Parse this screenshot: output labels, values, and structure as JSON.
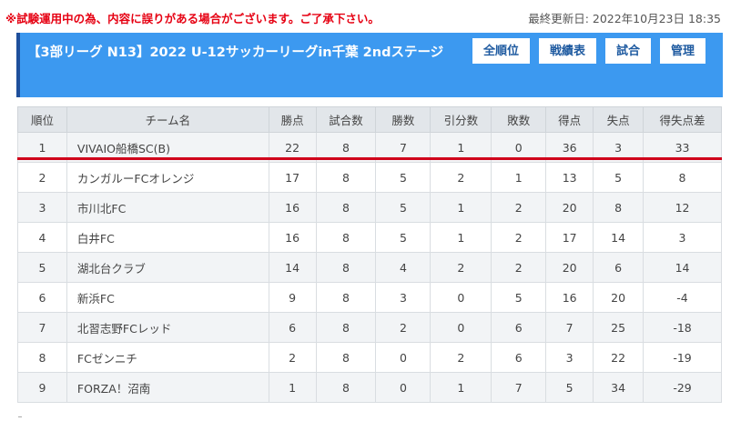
{
  "notice": "※試験運用中の為、内容に誤りがある場合がございます。ご了承下さい。",
  "last_updated": "最終更新日: 2022年10月23日 18:35",
  "header": {
    "title": "【3部リーグ N13】2022 U-12サッカーリーグin千葉 2ndステージ",
    "buttons": [
      "全順位",
      "戦績表",
      "試合",
      "管理"
    ]
  },
  "table": {
    "columns": [
      "順位",
      "チーム名",
      "勝点",
      "試合数",
      "勝数",
      "引分数",
      "敗数",
      "得点",
      "失点",
      "得失点差"
    ],
    "rows": [
      [
        "1",
        "VIVAIO船橋SC(B)",
        "22",
        "8",
        "7",
        "1",
        "0",
        "36",
        "3",
        "33"
      ],
      [
        "2",
        "カンガルーFCオレンジ",
        "17",
        "8",
        "5",
        "2",
        "1",
        "13",
        "5",
        "8"
      ],
      [
        "3",
        "市川北FC",
        "16",
        "8",
        "5",
        "1",
        "2",
        "20",
        "8",
        "12"
      ],
      [
        "4",
        "白井FC",
        "16",
        "8",
        "5",
        "1",
        "2",
        "17",
        "14",
        "3"
      ],
      [
        "5",
        "湖北台クラブ",
        "14",
        "8",
        "4",
        "2",
        "2",
        "20",
        "6",
        "14"
      ],
      [
        "6",
        "新浜FC",
        "9",
        "8",
        "3",
        "0",
        "5",
        "16",
        "20",
        "-4"
      ],
      [
        "7",
        "北習志野FCレッド",
        "6",
        "8",
        "2",
        "0",
        "6",
        "7",
        "25",
        "-18"
      ],
      [
        "8",
        "FCゼンニチ",
        "2",
        "8",
        "0",
        "2",
        "6",
        "3",
        "22",
        "-19"
      ],
      [
        "9",
        "FORZA！沼南",
        "1",
        "8",
        "0",
        "1",
        "7",
        "5",
        "34",
        "-29"
      ]
    ]
  }
}
